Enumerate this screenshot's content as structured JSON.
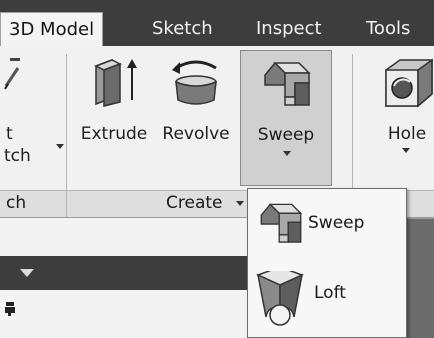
{
  "tabs": [
    {
      "label": "3D Model",
      "active": true
    },
    {
      "label": "Sketch",
      "active": false
    },
    {
      "label": "Inspect",
      "active": false
    },
    {
      "label": "Tools",
      "active": false
    }
  ],
  "ribbon": {
    "partial_sketch_label_1": "t",
    "partial_sketch_label_2": "tch",
    "extrude_label": "Extrude",
    "revolve_label": "Revolve",
    "sweep_label": "Sweep",
    "hole_label": "Hole",
    "panel_sketch_partial": "ch",
    "panel_create": "Create"
  },
  "dropdown": {
    "items": [
      {
        "label": "Sweep",
        "icon": "sweep-icon"
      },
      {
        "label": "Loft",
        "icon": "loft-icon"
      }
    ]
  },
  "colors": {
    "tab_bar": "#3d3d3d",
    "ribbon_bg": "#f1f1f1",
    "highlight": "#d0d0d0"
  }
}
